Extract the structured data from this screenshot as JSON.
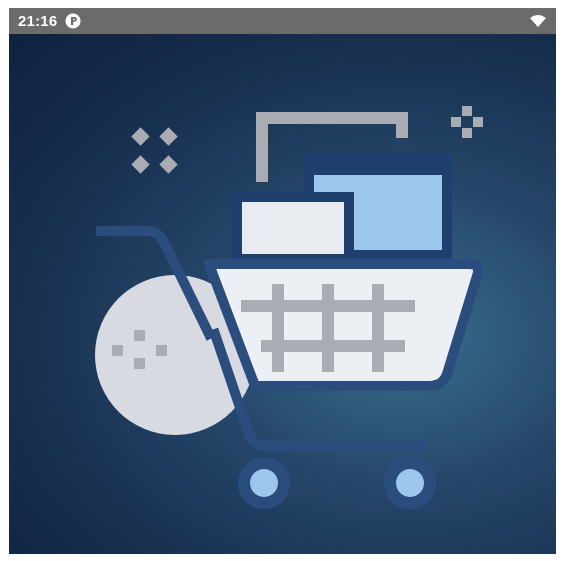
{
  "status_bar": {
    "time": "21:16",
    "notification_icon": "app-notification-icon",
    "wifi_icon": "wifi-signal-icon"
  },
  "splash": {
    "illustration": "shopping-cart-icon",
    "colors": {
      "background_dark": "#172e4e",
      "background_light": "#3a6e8f",
      "cart_outline": "#2a4d7e",
      "cart_body": "#eceff3",
      "accent_blue": "#9cc6ec",
      "grey": "#a9adb3"
    }
  }
}
